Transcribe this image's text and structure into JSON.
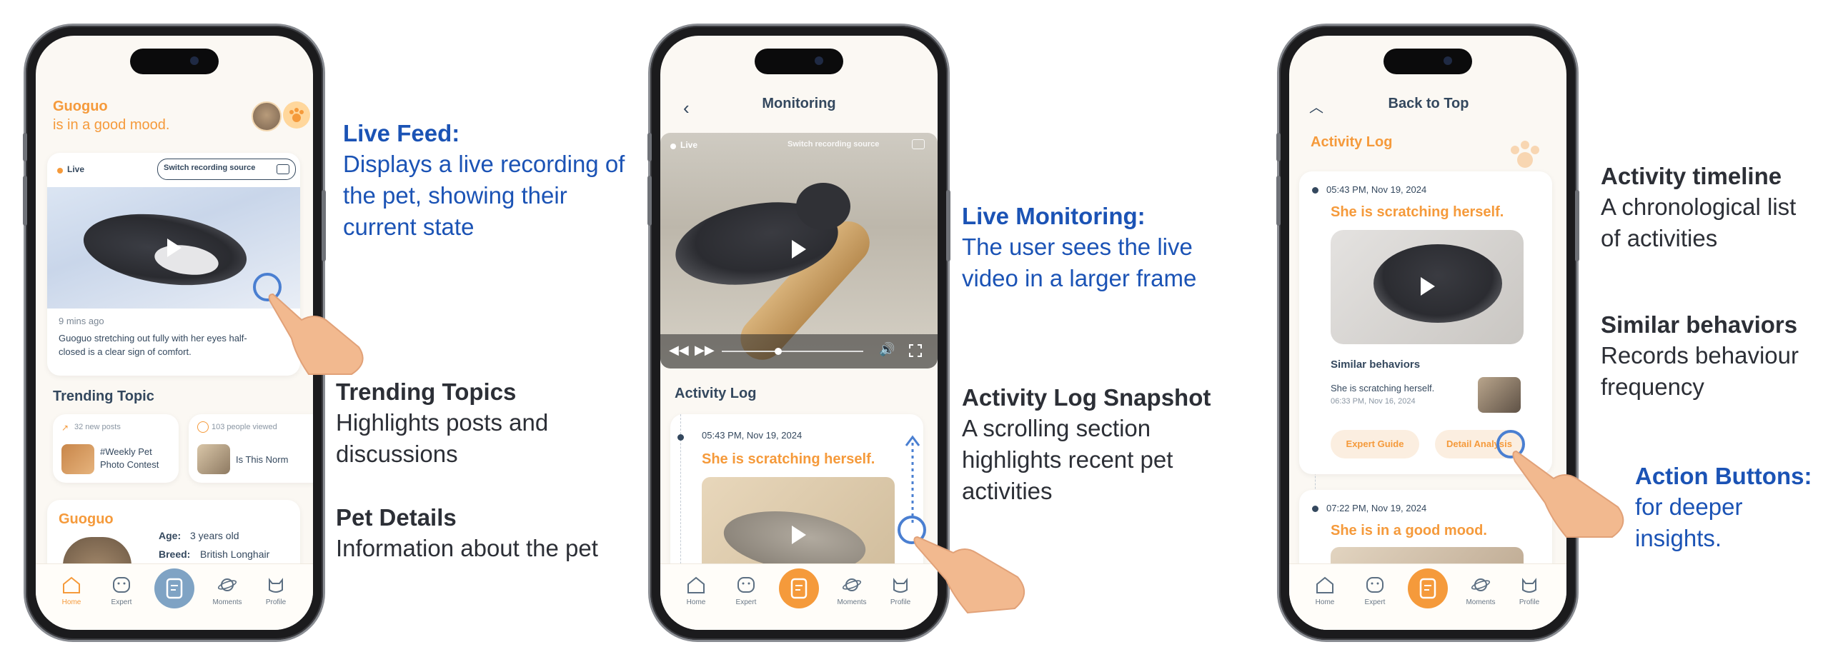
{
  "phone1": {
    "pet_name": "Guoguo",
    "mood": "is in a good mood.",
    "live_label": "Live",
    "switch_source": "Switch recording source",
    "time_ago": "9 mins ago",
    "feed_caption": "Guoguo stretching out fully with her eyes half-closed is a clear sign of comfort.",
    "trending_title": "Trending Topic",
    "topic1_meta": "32 new posts",
    "topic1_title": "#Weekly Pet Photo Contest",
    "topic2_meta": "103 people viewed",
    "topic2_title": "Is This Norm",
    "details_name": "Guoguo",
    "age_label": "Age:",
    "age_value": "3 years old",
    "breed_label": "Breed:",
    "breed_value": "British Longhair"
  },
  "phone2": {
    "title": "Monitoring",
    "live_label": "Live",
    "switch_source": "Switch recording source",
    "activity_title": "Activity Log",
    "entry_time": "05:43 PM, Nov 19, 2024",
    "entry_text": "She is scratching herself."
  },
  "phone3": {
    "back_to_top": "Back to Top",
    "activity_title": "Activity Log",
    "entry1_time": "05:43 PM, Nov 19, 2024",
    "entry1_text": "She is scratching herself.",
    "similar_title": "Similar behaviors",
    "similar_text": "She is scratching herself.",
    "similar_time": "06:33 PM, Nov 16, 2024",
    "btn_expert": "Expert Guide",
    "btn_detail": "Detail Analysis",
    "entry2_time": "07:22 PM, Nov 19, 2024",
    "entry2_text": "She is in a good mood."
  },
  "tabs": {
    "home": "Home",
    "expert": "Expert",
    "moments": "Moments",
    "profile": "Profile"
  },
  "annotations": {
    "live_feed_title": "Live Feed:",
    "live_feed_body": "Displays a live recording of the pet, showing their current state",
    "trending_title": "Trending Topics",
    "trending_body": "Highlights posts and discussions",
    "pet_details_title": "Pet Details",
    "pet_details_body": "Information about the pet",
    "live_monitoring_title": "Live Monitoring:",
    "live_monitoring_body": "The user sees the live video in a larger frame",
    "snapshot_title": "Activity Log Snapshot",
    "snapshot_body": "A scrolling section highlights recent pet activities",
    "timeline_title": "Activity timeline",
    "timeline_body": "A chronological list of activities",
    "similar_title": "Similar behaviors",
    "similar_body": "Records behaviour frequency",
    "action_title": "Action Buttons:",
    "action_body": "for deeper insights."
  },
  "colors": {
    "accent_orange": "#f59a3b",
    "navy_text": "#34485e",
    "annotation_blue": "#1b53b5",
    "annotation_dark": "#2c2f36"
  }
}
